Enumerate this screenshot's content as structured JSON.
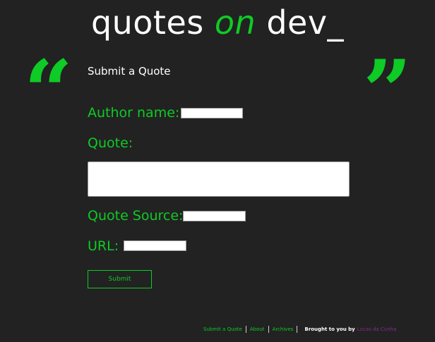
{
  "header": {
    "logo_part1": "quotes",
    "logo_part2": "on",
    "logo_part3": "dev_"
  },
  "decor": {
    "open_quote": "“",
    "close_quote": "”"
  },
  "form": {
    "title": "Submit a Quote",
    "author_label": "Author name:",
    "author_value": "",
    "quote_label": "Quote:",
    "quote_value": "",
    "source_label": "Quote Source:",
    "source_value": "",
    "url_label": "URL:",
    "url_value": "",
    "submit_label": "Submit"
  },
  "footer": {
    "links": [
      "Submit a Quote",
      "About",
      "Archives"
    ],
    "credit_text": "Brought to you by",
    "credit_author": "Lucas da Cunha"
  },
  "colors": {
    "background": "#222222",
    "accent": "#0ecb25",
    "text": "#ffffff",
    "author_link": "#8a2b8a"
  }
}
